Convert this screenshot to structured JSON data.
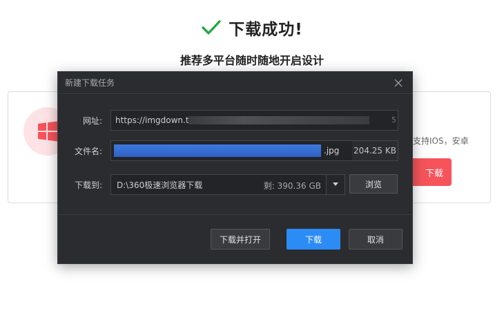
{
  "background": {
    "success_title": "下载成功!",
    "subtitle": "推荐多平台随时随地开启设计",
    "card_desc": "支持IOS，安卓",
    "download_button": "下载",
    "success_color": "#27a844",
    "accent_red": "#f6535b"
  },
  "dialog": {
    "title": "新建下载任务",
    "url_label": "网址:",
    "url_value": "https://imgdown.t",
    "url_tail": "5",
    "filename_label": "文件名:",
    "filename_ext": ".jpg",
    "file_size": "204.25 KB",
    "save_to_label": "下载到:",
    "save_path": "D:\\360极速浏览器下载",
    "free_space": "剩: 390.36 GB",
    "browse_button": "浏览",
    "download_and_open_button": "下载并打开",
    "download_button": "下载",
    "cancel_button": "取消",
    "primary_color": "#2b8cf5"
  },
  "icons": {
    "success": "check-icon",
    "os": "windows-logo-icon",
    "close": "close-icon",
    "dropdown": "chevron-down-icon"
  }
}
